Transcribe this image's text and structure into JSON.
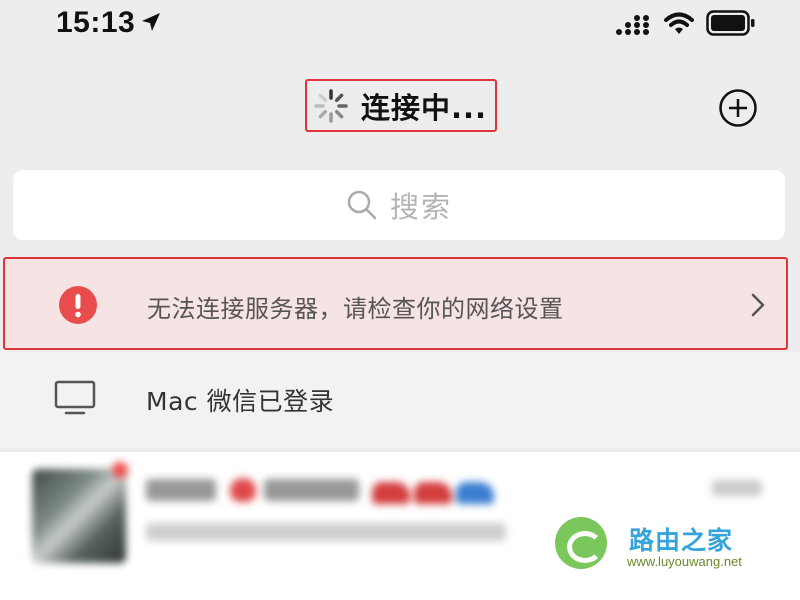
{
  "status_bar": {
    "time": "15:13",
    "icons": [
      "location-arrow-icon",
      "signal-icon",
      "wifi-icon",
      "battery-icon"
    ]
  },
  "header": {
    "title": "连接中...",
    "spinner_icon": "loading-spinner-icon",
    "add_icon": "plus-circle-icon"
  },
  "search": {
    "placeholder": "搜索",
    "icon": "search-icon"
  },
  "error_banner": {
    "message": "无法连接服务器，请检查你的网络设置",
    "icon": "exclamation-icon",
    "accent_color": "#e84c4c",
    "chevron_icon": "chevron-right-icon"
  },
  "mac_status": {
    "text": "Mac 微信已登录",
    "icon": "monitor-icon"
  },
  "watermark": {
    "title": "路由之家",
    "url": "www.luyouwang.net"
  },
  "colors": {
    "highlight_border": "#e0343c",
    "banner_background": "#f6e3e4",
    "page_background": "#ededed"
  }
}
